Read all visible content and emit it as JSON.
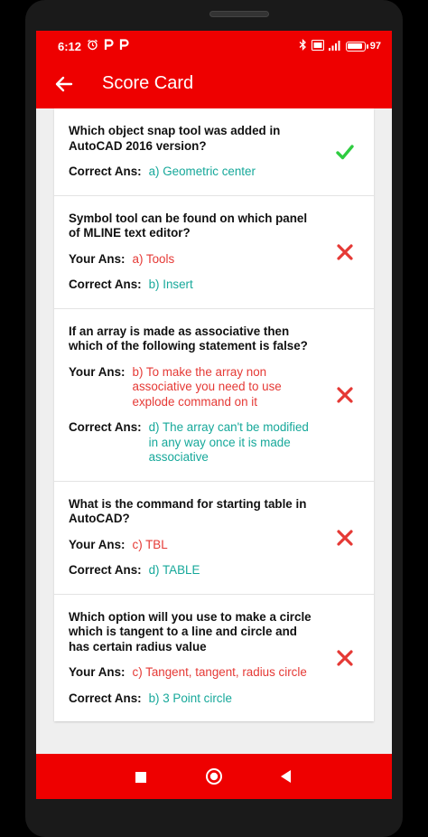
{
  "status_bar": {
    "time": "6:12",
    "battery_percent": "97"
  },
  "app_bar": {
    "title": "Score Card",
    "back_icon": "arrow-back-icon"
  },
  "colors": {
    "primary": "#ee0000",
    "correct": "#16a89a",
    "wrong": "#e53935",
    "check": "#2ecc40"
  },
  "labels": {
    "your_ans": "Your Ans:",
    "correct_ans": "Correct Ans:"
  },
  "questions": [
    {
      "question": "Which object snap tool was added in AutoCAD 2016 version?",
      "your_answer": null,
      "correct_answer": "a) Geometric center",
      "result": "correct"
    },
    {
      "question": "Symbol tool can be found on which panel of MLINE text editor?",
      "your_answer": "a) Tools",
      "correct_answer": "b) Insert",
      "result": "wrong"
    },
    {
      "question": "If an array is made as associative then which of the following statement is false?",
      "your_answer": "b) To make the array non associative you need to use explode command on it",
      "correct_answer": "d) The array can't be modified in any way once it is made associative",
      "result": "wrong"
    },
    {
      "question": "What is the command for starting table in AutoCAD?",
      "your_answer": "c) TBL",
      "correct_answer": "d) TABLE",
      "result": "wrong"
    },
    {
      "question": "Which option will you use to make a circle which is tangent to a line and circle and has certain radius value",
      "your_answer": "c) Tangent, tangent, radius circle",
      "correct_answer": "b) 3 Point circle",
      "result": "wrong"
    }
  ],
  "nav_bar": {
    "recents_icon": "square-icon",
    "home_icon": "circle-home-icon",
    "back_icon": "triangle-back-icon"
  }
}
